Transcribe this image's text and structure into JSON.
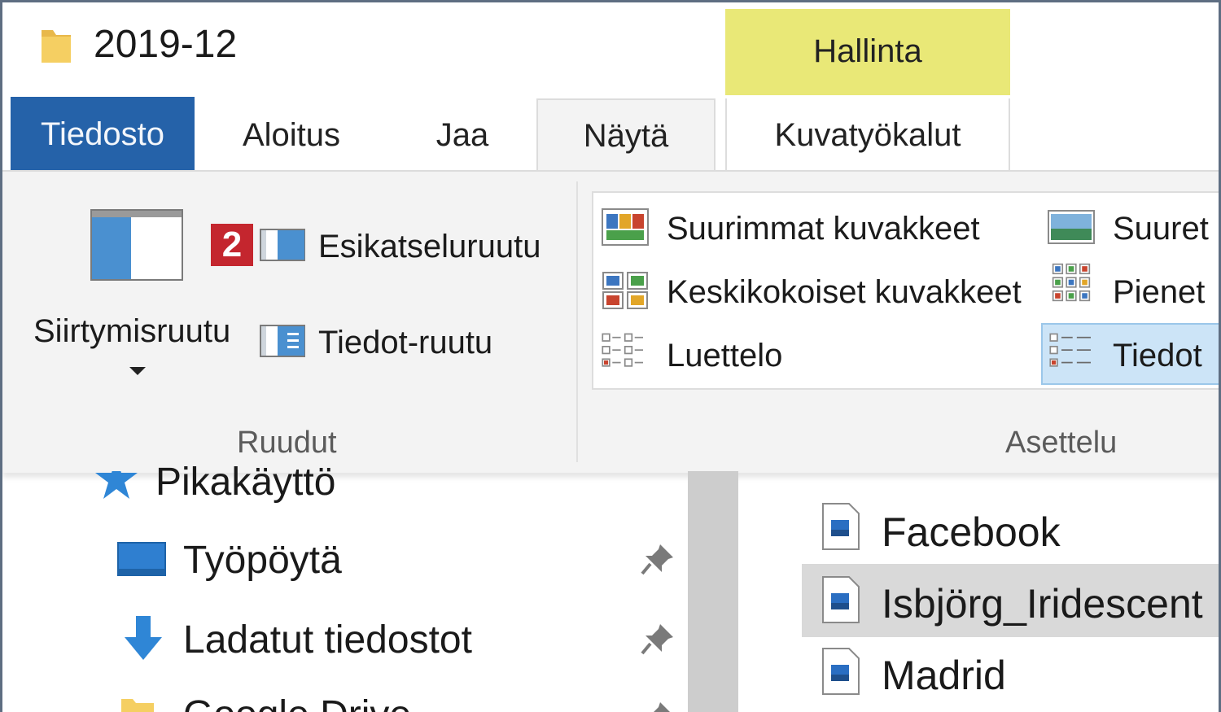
{
  "window": {
    "title": "2019-12"
  },
  "ribbon_tabs": {
    "contextual_group": "Hallinta",
    "file": "Tiedosto",
    "home": "Aloitus",
    "share": "Jaa",
    "view": "Näytä",
    "picture_tools": "Kuvatyökalut"
  },
  "panes_group": {
    "navigation_pane": "Siirtymisruutu",
    "badge": "2",
    "preview_pane": "Esikatseluruutu",
    "details_pane": "Tiedot-ruutu",
    "label": "Ruudut"
  },
  "layout_group": {
    "items": [
      "Suurimmat kuvakkeet",
      "Suuret",
      "Keskikokoiset kuvakkeet",
      "Pienet",
      "Luettelo",
      "Tiedot"
    ],
    "selected": "Tiedot",
    "label": "Asettelu"
  },
  "navigation": {
    "items": [
      "Pikakäyttö",
      "Työpöytä",
      "Ladatut tiedostot",
      "Google Drive"
    ]
  },
  "files": {
    "items": [
      "Facebook",
      "Isbjörg_Iridescent",
      "Madrid"
    ],
    "selected": "Isbjörg_Iridescent"
  },
  "colors": {
    "file_tab": "#2562a9",
    "contextual_group": "#e9e877",
    "badge": "#c4262e",
    "selection": "#cce4f7"
  }
}
